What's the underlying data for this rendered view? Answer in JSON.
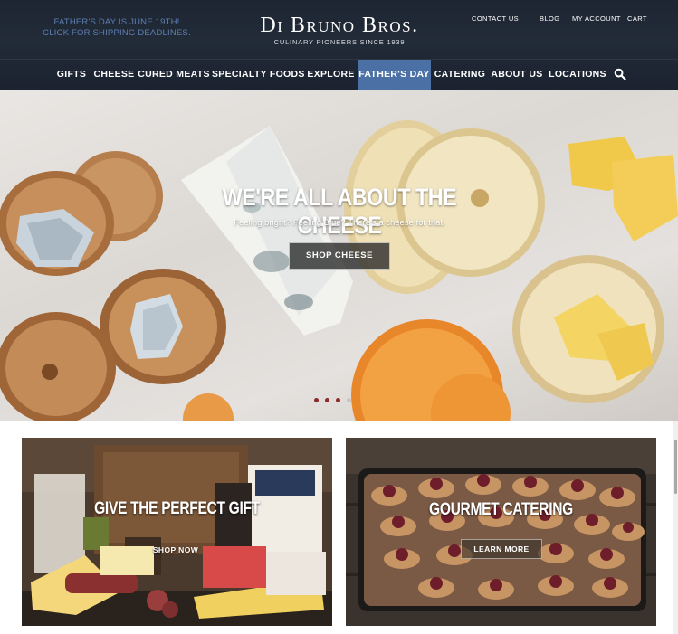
{
  "header": {
    "promo_line1": "FATHER'S DAY IS JUNE 19TH!",
    "promo_line2": "CLICK FOR SHIPPING DEADLINES.",
    "logo_title": "Di Bruno Bros.",
    "logo_subtitle": "CULINARY PIONEERS SINCE 1939",
    "utility_links": [
      "CONTACT US",
      "BLOG",
      "MY ACCOUNT",
      "CART"
    ]
  },
  "nav": {
    "items": [
      "GIFTS",
      "CHEESE",
      "CURED MEATS",
      "SPECIALTY FOODS",
      "EXPLORE",
      "FATHER'S DAY",
      "CATERING",
      "ABOUT US",
      "LOCATIONS"
    ],
    "active": "FATHER'S DAY",
    "search_icon": "search-icon"
  },
  "hero": {
    "title": "WE'RE ALL ABOUT THE CHEESE",
    "subtitle": "Feeling bright? Feeling Blue? There's a cheese for that.",
    "button": "SHOP CHEESE",
    "slide_count": 4,
    "active_slide": 4
  },
  "tiles": [
    {
      "title": "GIVE THE PERFECT GIFT",
      "button": "SHOP NOW"
    },
    {
      "title": "GOURMET CATERING",
      "button": "LEARN MORE"
    }
  ],
  "colors": {
    "header_bg": "#1f2733",
    "nav_active": "#4a70a6",
    "promo_text": "#5d7fb3",
    "dot": "#8a2a2a"
  }
}
